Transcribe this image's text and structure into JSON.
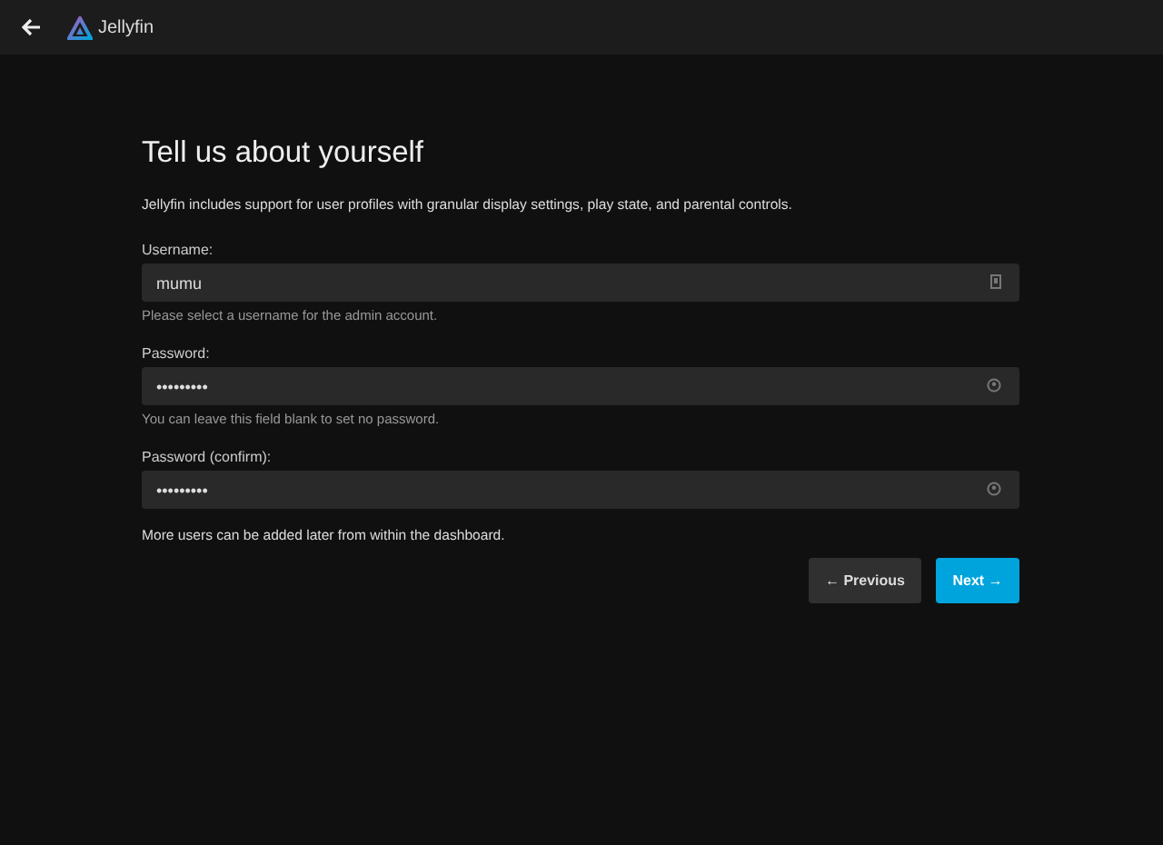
{
  "header": {
    "app_name": "Jellyfin"
  },
  "title": "Tell us about yourself",
  "description": "Jellyfin includes support for user profiles with granular display settings, play state, and parental controls.",
  "fields": [
    {
      "kind": "text",
      "label": "Username:",
      "value": "mumu",
      "help": "Please select a username for the admin account."
    },
    {
      "kind": "password",
      "label": "Password:",
      "value": "•••••••••",
      "help": "You can leave this field blank to set no password."
    },
    {
      "kind": "password",
      "label": "Password (confirm):",
      "value": "•••••••••"
    }
  ],
  "note": "More users can be added later from within the dashboard.",
  "buttons": [
    {
      "kind": "previous",
      "label": "← Previous"
    },
    {
      "kind": "next",
      "label": "Next →"
    }
  ]
}
